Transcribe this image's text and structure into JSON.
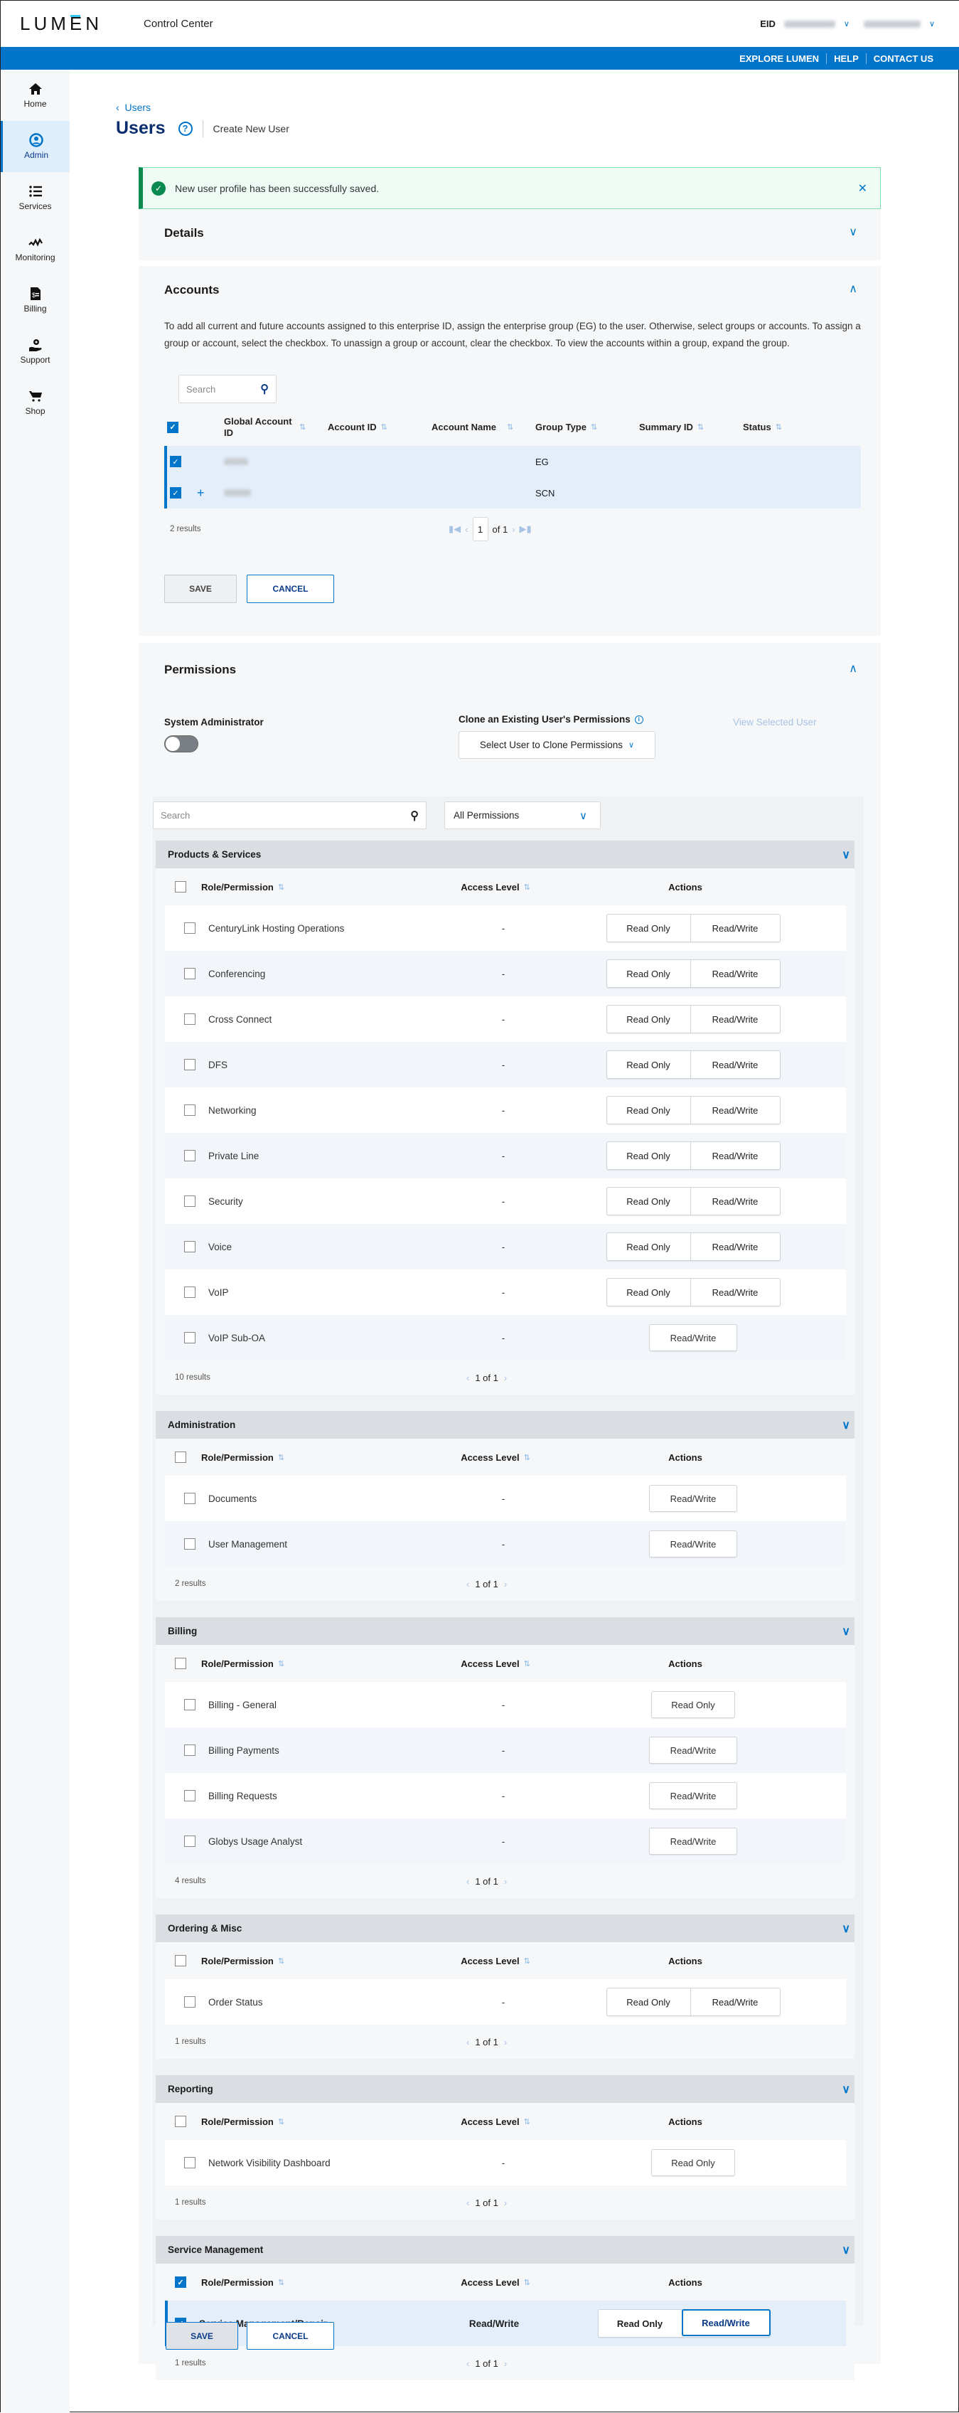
{
  "header": {
    "logo": "LUMEN",
    "app_name": "Control Center",
    "eid_label": "EID",
    "eid_value": "100642377",
    "username": "mathusansah"
  },
  "topbar": {
    "links": [
      "EXPLORE LUMEN",
      "HELP",
      "CONTACT US"
    ]
  },
  "sidebar": {
    "items": [
      {
        "label": "Home",
        "icon": "home-icon",
        "active": false
      },
      {
        "label": "Admin",
        "icon": "user-circle-icon",
        "active": true
      },
      {
        "label": "Services",
        "icon": "list-icon",
        "active": false
      },
      {
        "label": "Monitoring",
        "icon": "pulse-icon",
        "active": false
      },
      {
        "label": "Billing",
        "icon": "bill-icon",
        "active": false
      },
      {
        "label": "Support",
        "icon": "support-icon",
        "active": false
      },
      {
        "label": "Shop",
        "icon": "cart-icon",
        "active": false
      }
    ]
  },
  "breadcrumb": {
    "back_label": "Users"
  },
  "page": {
    "title": "Users",
    "subtitle": "Create New User"
  },
  "alert": {
    "message": "New user profile has been successfully saved."
  },
  "details": {
    "title": "Details"
  },
  "accounts": {
    "title": "Accounts",
    "description": "To add all current and future accounts assigned to this enterprise ID, assign the enterprise group (EG) to the user. Otherwise, select groups or accounts. To assign a group or account, select the checkbox. To unassign a group or account, clear the checkbox. To view the accounts within a group, expand the group.",
    "search_placeholder": "Search",
    "columns": [
      "Global Account ID",
      "Account ID",
      "Account Name",
      "Group Type",
      "Summary ID",
      "Status"
    ],
    "rows": [
      {
        "global_account_id": "1117667",
        "account_id": "",
        "account_name": "",
        "group_type": "EG",
        "summary_id": "",
        "status": "",
        "expandable": false,
        "checked": true
      },
      {
        "global_account_id": "2-GCXW6",
        "account_id": "",
        "account_name": "",
        "group_type": "SCN",
        "summary_id": "",
        "status": "",
        "expandable": true,
        "checked": true
      }
    ],
    "results": "2 results",
    "page": "1",
    "of_label": "of 1",
    "save_label": "SAVE",
    "cancel_label": "CANCEL"
  },
  "permissions": {
    "title": "Permissions",
    "sysadmin_label": "System Administrator",
    "sysadmin_on": false,
    "clone_label": "Clone an Existing User's Permissions",
    "clone_select": "Select User to Clone Permissions",
    "view_selected_user": "View Selected User",
    "search_placeholder": "Search",
    "filter_value": "All Permissions",
    "col_role": "Role/Permission",
    "col_access": "Access Level",
    "col_actions": "Actions",
    "read_only": "Read Only",
    "read_write": "Read/Write",
    "pager": "1 of 1",
    "groups": [
      {
        "name": "Products & Services",
        "results": "10 results",
        "rows": [
          {
            "name": "CenturyLink Hosting Operations",
            "level": "-",
            "actions": [
              "ro",
              "rw"
            ]
          },
          {
            "name": "Conferencing",
            "level": "-",
            "actions": [
              "ro",
              "rw"
            ]
          },
          {
            "name": "Cross Connect",
            "level": "-",
            "actions": [
              "ro",
              "rw"
            ]
          },
          {
            "name": "DFS",
            "level": "-",
            "actions": [
              "ro",
              "rw"
            ]
          },
          {
            "name": "Networking",
            "level": "-",
            "actions": [
              "ro",
              "rw"
            ]
          },
          {
            "name": "Private Line",
            "level": "-",
            "actions": [
              "ro",
              "rw"
            ]
          },
          {
            "name": "Security",
            "level": "-",
            "actions": [
              "ro",
              "rw"
            ]
          },
          {
            "name": "Voice",
            "level": "-",
            "actions": [
              "ro",
              "rw"
            ]
          },
          {
            "name": "VoIP",
            "level": "-",
            "actions": [
              "ro",
              "rw"
            ]
          },
          {
            "name": "VoIP Sub-OA",
            "level": "-",
            "actions": [
              "rw"
            ]
          }
        ]
      },
      {
        "name": "Administration",
        "results": "2 results",
        "rows": [
          {
            "name": "Documents",
            "level": "-",
            "actions": [
              "rw"
            ]
          },
          {
            "name": "User Management",
            "level": "-",
            "actions": [
              "rw"
            ]
          }
        ]
      },
      {
        "name": "Billing",
        "results": "4 results",
        "rows": [
          {
            "name": "Billing - General",
            "level": "-",
            "actions": [
              "ro"
            ]
          },
          {
            "name": "Billing Payments",
            "level": "-",
            "actions": [
              "rw"
            ]
          },
          {
            "name": "Billing Requests",
            "level": "-",
            "actions": [
              "rw"
            ]
          },
          {
            "name": "Globys Usage Analyst",
            "level": "-",
            "actions": [
              "rw"
            ]
          }
        ]
      },
      {
        "name": "Ordering & Misc",
        "results": "1 results",
        "rows": [
          {
            "name": "Order Status",
            "level": "-",
            "actions": [
              "ro",
              "rw"
            ]
          }
        ]
      },
      {
        "name": "Reporting",
        "results": "1 results",
        "rows": [
          {
            "name": "Network Visibility Dashboard",
            "level": "-",
            "actions": [
              "ro"
            ]
          }
        ]
      },
      {
        "name": "Service Management",
        "results": "1 results",
        "header_checked": true,
        "rows": [
          {
            "name": "Service Management/Repair",
            "level": "Read/Write",
            "actions": [
              "ro",
              "rw"
            ],
            "selected": true,
            "active": "rw"
          }
        ]
      }
    ],
    "save_label": "SAVE",
    "cancel_label": "CANCEL"
  }
}
